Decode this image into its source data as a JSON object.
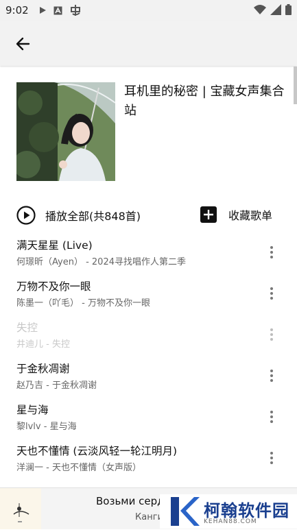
{
  "status_bar": {
    "time": "9:02",
    "icons": [
      "play-icon",
      "font-icon",
      "chinese-app-icon"
    ],
    "right_icons": [
      "wifi-icon",
      "signal-icon",
      "battery-icon"
    ]
  },
  "app_bar": {
    "back_icon": "arrow-left-icon"
  },
  "playlist": {
    "title": "耳机里的秘密 | 宝藏女声集合站",
    "play_all_label": "播放全部(共848首)",
    "collect_label": "收藏歌单"
  },
  "songs": [
    {
      "title": "满天星星 (Live)",
      "subtitle": "何璟昕（Ayen） - 2024寻找唱作人第二季",
      "available": true
    },
    {
      "title": "万物不及你一眼",
      "subtitle": "陈墨一（吖毛） - 万物不及你一眼",
      "available": true
    },
    {
      "title": "失控",
      "subtitle": "井迪儿 - 失控",
      "available": false
    },
    {
      "title": "于金秋凋谢",
      "subtitle": "赵乃吉 - 于金秋凋谢",
      "available": true
    },
    {
      "title": "星与海",
      "subtitle": "黎lvlv - 星与海",
      "available": true
    },
    {
      "title": "天也不懂情 (云淡风轻一轮江明月)",
      "subtitle": "洋澜一 - 天也不懂情（女声版）",
      "available": true
    }
  ],
  "mini_player": {
    "title": "Возьми серд",
    "subtitle": "Канги"
  },
  "watermark": {
    "text": "柯翰软件园",
    "sub": "KEHAN88.COM"
  },
  "colors": {
    "background": "#ffffff",
    "appbar": "#f2f2f2",
    "disabled_text": "#c8c8c8",
    "watermark_blue": "#1a3f8f"
  }
}
